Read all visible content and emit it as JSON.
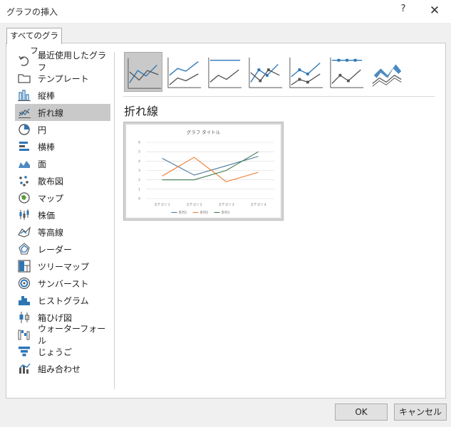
{
  "window": {
    "title": "グラフの挿入",
    "help_icon": "?",
    "close_icon": "✕"
  },
  "tab": {
    "label": "すべてのグラフ"
  },
  "sidebar": {
    "items": [
      {
        "label": "最近使用したグラフ",
        "icon": "recent-icon"
      },
      {
        "label": "テンプレート",
        "icon": "folder-icon"
      },
      {
        "label": "縦棒",
        "icon": "column-chart-icon"
      },
      {
        "label": "折れ線",
        "icon": "line-chart-icon",
        "selected": true
      },
      {
        "label": "円",
        "icon": "pie-chart-icon"
      },
      {
        "label": "横棒",
        "icon": "bar-chart-icon"
      },
      {
        "label": "面",
        "icon": "area-chart-icon"
      },
      {
        "label": "散布図",
        "icon": "scatter-chart-icon"
      },
      {
        "label": "マップ",
        "icon": "map-chart-icon"
      },
      {
        "label": "株価",
        "icon": "stock-chart-icon"
      },
      {
        "label": "等高線",
        "icon": "surface-chart-icon"
      },
      {
        "label": "レーダー",
        "icon": "radar-chart-icon"
      },
      {
        "label": "ツリーマップ",
        "icon": "treemap-chart-icon"
      },
      {
        "label": "サンバースト",
        "icon": "sunburst-chart-icon"
      },
      {
        "label": "ヒストグラム",
        "icon": "histogram-chart-icon"
      },
      {
        "label": "箱ひげ図",
        "icon": "box-whisker-chart-icon"
      },
      {
        "label": "ウォーターフォール",
        "icon": "waterfall-chart-icon"
      },
      {
        "label": "じょうご",
        "icon": "funnel-chart-icon"
      },
      {
        "label": "組み合わせ",
        "icon": "combo-chart-icon"
      }
    ]
  },
  "subtypes": [
    {
      "name": "line",
      "selected": true
    },
    {
      "name": "stacked-line"
    },
    {
      "name": "100-stacked-line"
    },
    {
      "name": "line-with-markers"
    },
    {
      "name": "stacked-line-with-markers"
    },
    {
      "name": "100-stacked-line-with-markers"
    },
    {
      "name": "3d-line"
    }
  ],
  "selected_chart": {
    "title": "折れ線"
  },
  "chart_data": {
    "type": "line",
    "title": "グラフ タイトル",
    "categories": [
      "カテゴリ 1",
      "カテゴリ 2",
      "カテゴリ 3",
      "カテゴリ 4"
    ],
    "series": [
      {
        "name": "系列1",
        "values": [
          4.3,
          2.5,
          3.5,
          4.5
        ],
        "color": "#4a7a9d"
      },
      {
        "name": "系列2",
        "values": [
          2.4,
          4.4,
          1.8,
          2.8
        ],
        "color": "#ed7d31"
      },
      {
        "name": "系列3",
        "values": [
          2,
          2,
          3,
          5
        ],
        "color": "#3e7a4e"
      }
    ],
    "ylim": [
      0,
      6
    ],
    "yticks": [
      "0",
      "1",
      "2",
      "3",
      "4",
      "5",
      "6"
    ],
    "grid": true,
    "legend": "bottom"
  },
  "colors": {
    "accent": "#2e75b6",
    "selected_bg": "#c9c9c9"
  },
  "buttons": {
    "ok": "OK",
    "cancel": "キャンセル"
  }
}
